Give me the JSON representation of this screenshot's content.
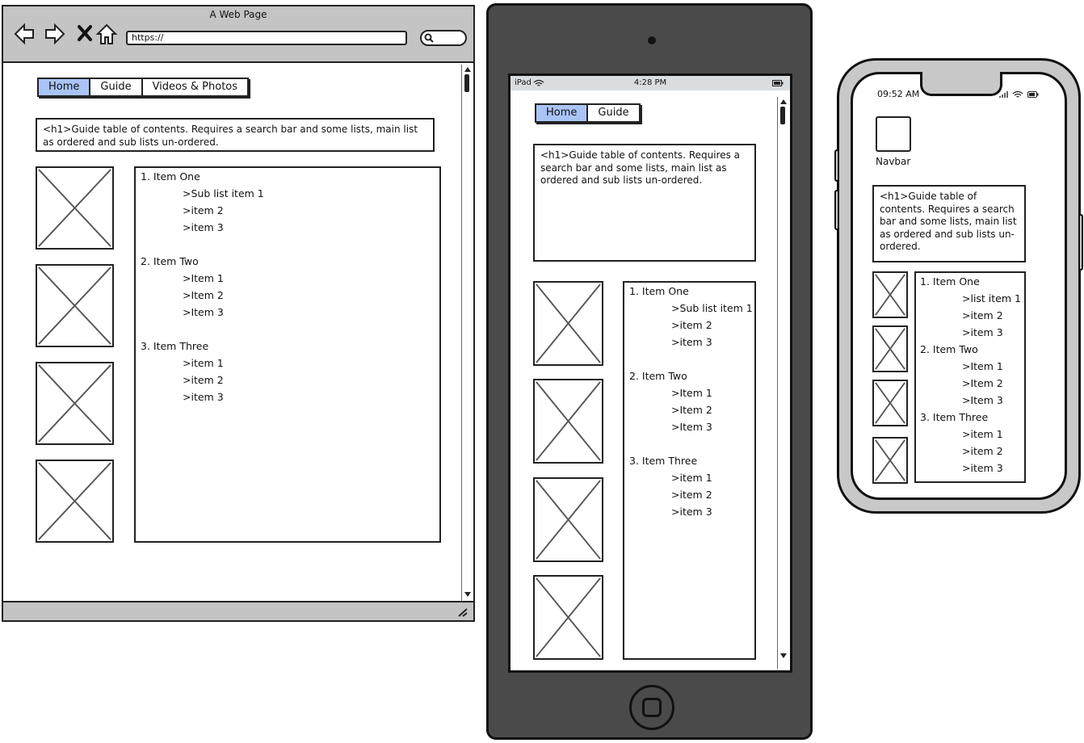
{
  "browser": {
    "title": "A Web Page",
    "url": "https://",
    "nav": {
      "back_icon": "back-arrow-icon",
      "forward_icon": "forward-arrow-icon",
      "stop_icon": "close-icon",
      "home_icon": "home-icon"
    },
    "tabs": [
      "Home",
      "Guide",
      "Videos & Photos"
    ],
    "heading_text": "<h1>Guide table of contents.  Requires a search bar and some lists, main list as ordered and sub lists un-ordered.",
    "list": [
      {
        "label": "1. Item One",
        "sub": [
          ">Sub list item 1",
          ">item 2",
          ">item 3"
        ]
      },
      {
        "label": "2. Item Two",
        "sub": [
          ">Item 1",
          ">Item 2",
          ">Item 3"
        ]
      },
      {
        "label": "3. Item Three",
        "sub": [
          ">item 1",
          ">item 2",
          ">item 3"
        ]
      }
    ]
  },
  "ipad": {
    "status_left": "iPad",
    "status_time": "4:28 PM",
    "tabs": [
      "Home",
      "Guide"
    ],
    "heading_text": "<h1>Guide table of contents.  Requires a search bar and some lists, main list as ordered and sub lists un-ordered.",
    "list": [
      {
        "label": "1. Item One",
        "sub": [
          ">Sub list item 1",
          ">item 2",
          ">item 3"
        ]
      },
      {
        "label": "2. Item Two",
        "sub": [
          ">Item 1",
          ">Item 2",
          ">Item 3"
        ]
      },
      {
        "label": "3. Item Three",
        "sub": [
          ">item 1",
          ">item 2",
          ">item 3"
        ]
      }
    ]
  },
  "phone": {
    "status_time": "09:52 AM",
    "navbar_label": "Navbar",
    "heading_text": "<h1>Guide table of contents. Requires a search bar and some lists, main list as ordered and sub lists un-ordered.",
    "list": [
      {
        "label": "1. Item One",
        "sub": [
          ">list item 1",
          ">item 2",
          ">item 3"
        ]
      },
      {
        "label": "2. Item Two",
        "sub": [
          ">Item 1",
          ">Item 2",
          ">Item 3"
        ]
      },
      {
        "label": "3. Item Three",
        "sub": [
          ">item 1",
          ">item 2",
          ">item 3"
        ]
      }
    ]
  }
}
